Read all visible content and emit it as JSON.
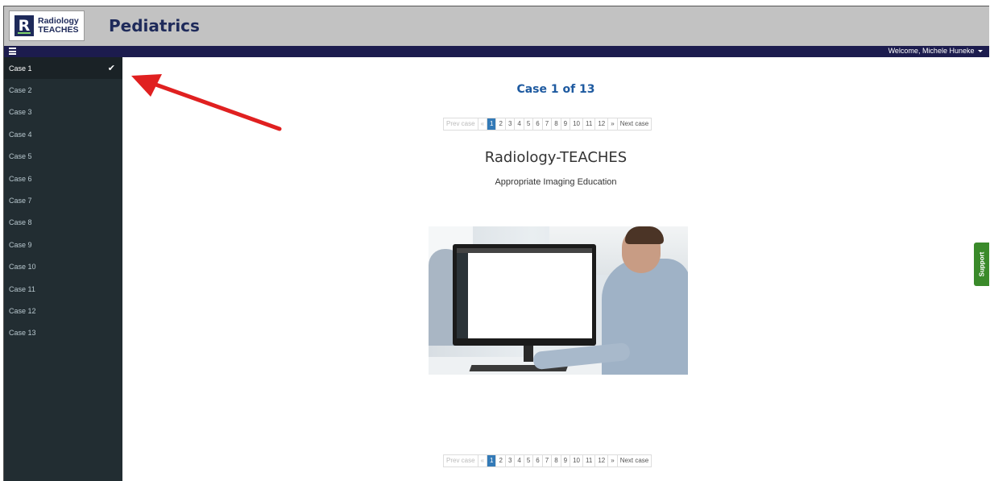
{
  "header": {
    "logo_line1": "Radiology",
    "logo_line2": "TEACHES",
    "logo_letter": "R",
    "title": "Pediatrics"
  },
  "navbar": {
    "welcome": "Welcome, Michele Huneke"
  },
  "sidebar": {
    "items": [
      {
        "label": "Case 1"
      },
      {
        "label": "Case 2"
      },
      {
        "label": "Case 3"
      },
      {
        "label": "Case 4"
      },
      {
        "label": "Case 5"
      },
      {
        "label": "Case 6"
      },
      {
        "label": "Case 7"
      },
      {
        "label": "Case 8"
      },
      {
        "label": "Case 9"
      },
      {
        "label": "Case 10"
      },
      {
        "label": "Case 11"
      },
      {
        "label": "Case 12"
      },
      {
        "label": "Case 13"
      }
    ],
    "active_index": 0,
    "check_glyph": "✔"
  },
  "main": {
    "case_title": "Case 1 of 13",
    "site_title": "Radiology-TEACHES",
    "site_subtitle": "Appropriate Imaging Education"
  },
  "pager": {
    "prev": "Prev case",
    "first": "«",
    "pages": [
      "1",
      "2",
      "3",
      "4",
      "5",
      "6",
      "7",
      "8",
      "9",
      "10",
      "11",
      "12"
    ],
    "last": "»",
    "next": "Next case",
    "current": "1"
  },
  "support": {
    "label": "Support"
  },
  "colors": {
    "header_bg": "#c2c2c2",
    "navbar_bg": "#1c1c4e",
    "sidebar_bg": "#222d32",
    "title_blue": "#1e5aa0",
    "pager_active": "#337ab7",
    "support_green": "#3a8a2a",
    "arrow_red": "#e02020"
  }
}
